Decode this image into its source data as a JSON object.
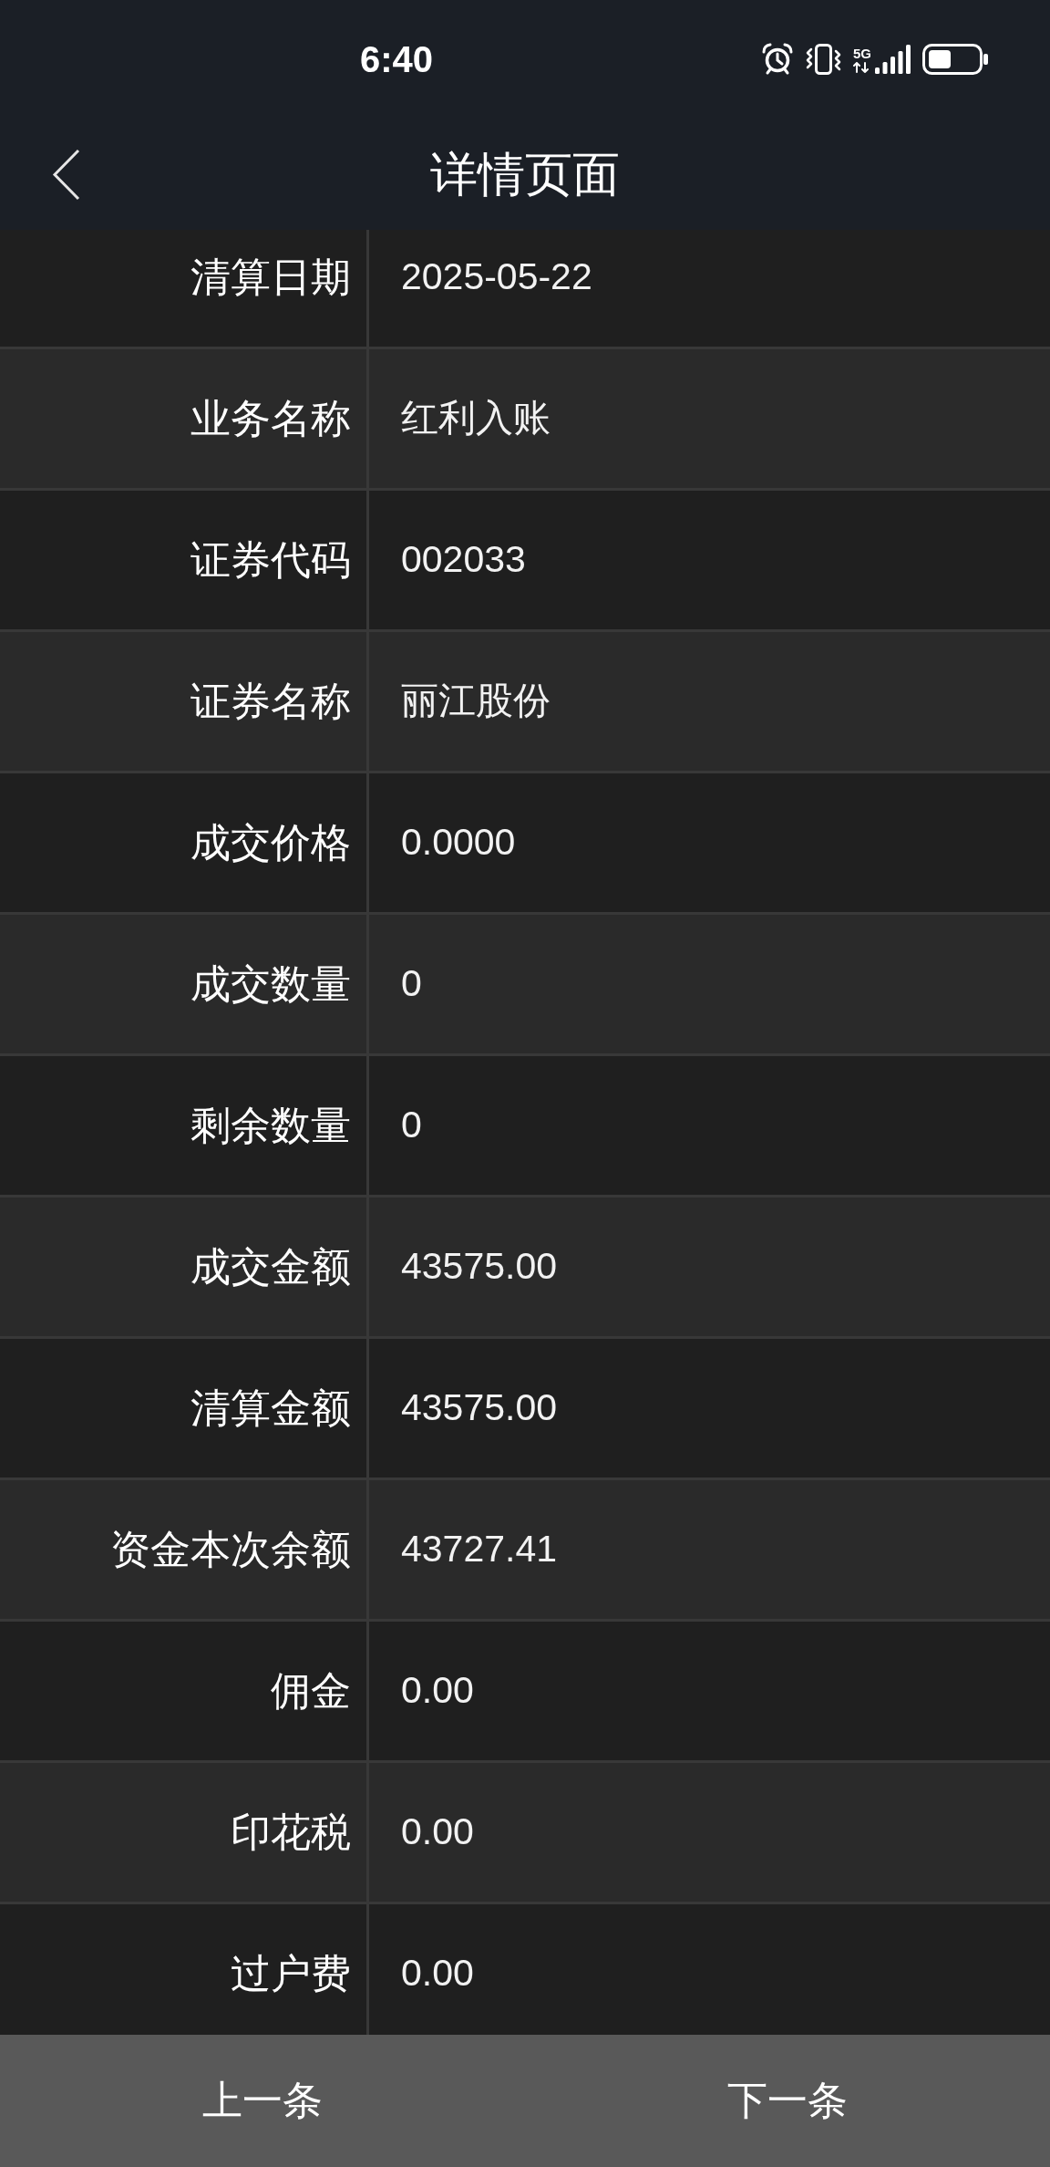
{
  "status_bar": {
    "time": "6:40",
    "network_type": "5G"
  },
  "header": {
    "title": "详情页面"
  },
  "details": [
    {
      "label": "清算日期",
      "value": "2025-05-22"
    },
    {
      "label": "业务名称",
      "value": "红利入账"
    },
    {
      "label": "证券代码",
      "value": "002033"
    },
    {
      "label": "证券名称",
      "value": "丽江股份"
    },
    {
      "label": "成交价格",
      "value": "0.0000"
    },
    {
      "label": "成交数量",
      "value": "0"
    },
    {
      "label": "剩余数量",
      "value": "0"
    },
    {
      "label": "成交金额",
      "value": "43575.00"
    },
    {
      "label": "清算金额",
      "value": "43575.00"
    },
    {
      "label": "资金本次余额",
      "value": "43727.41"
    },
    {
      "label": "佣金",
      "value": "0.00"
    },
    {
      "label": "印花税",
      "value": "0.00"
    },
    {
      "label": "过户费",
      "value": "0.00"
    }
  ],
  "footer": {
    "buttons": [
      "上一条",
      "下一条"
    ]
  }
}
